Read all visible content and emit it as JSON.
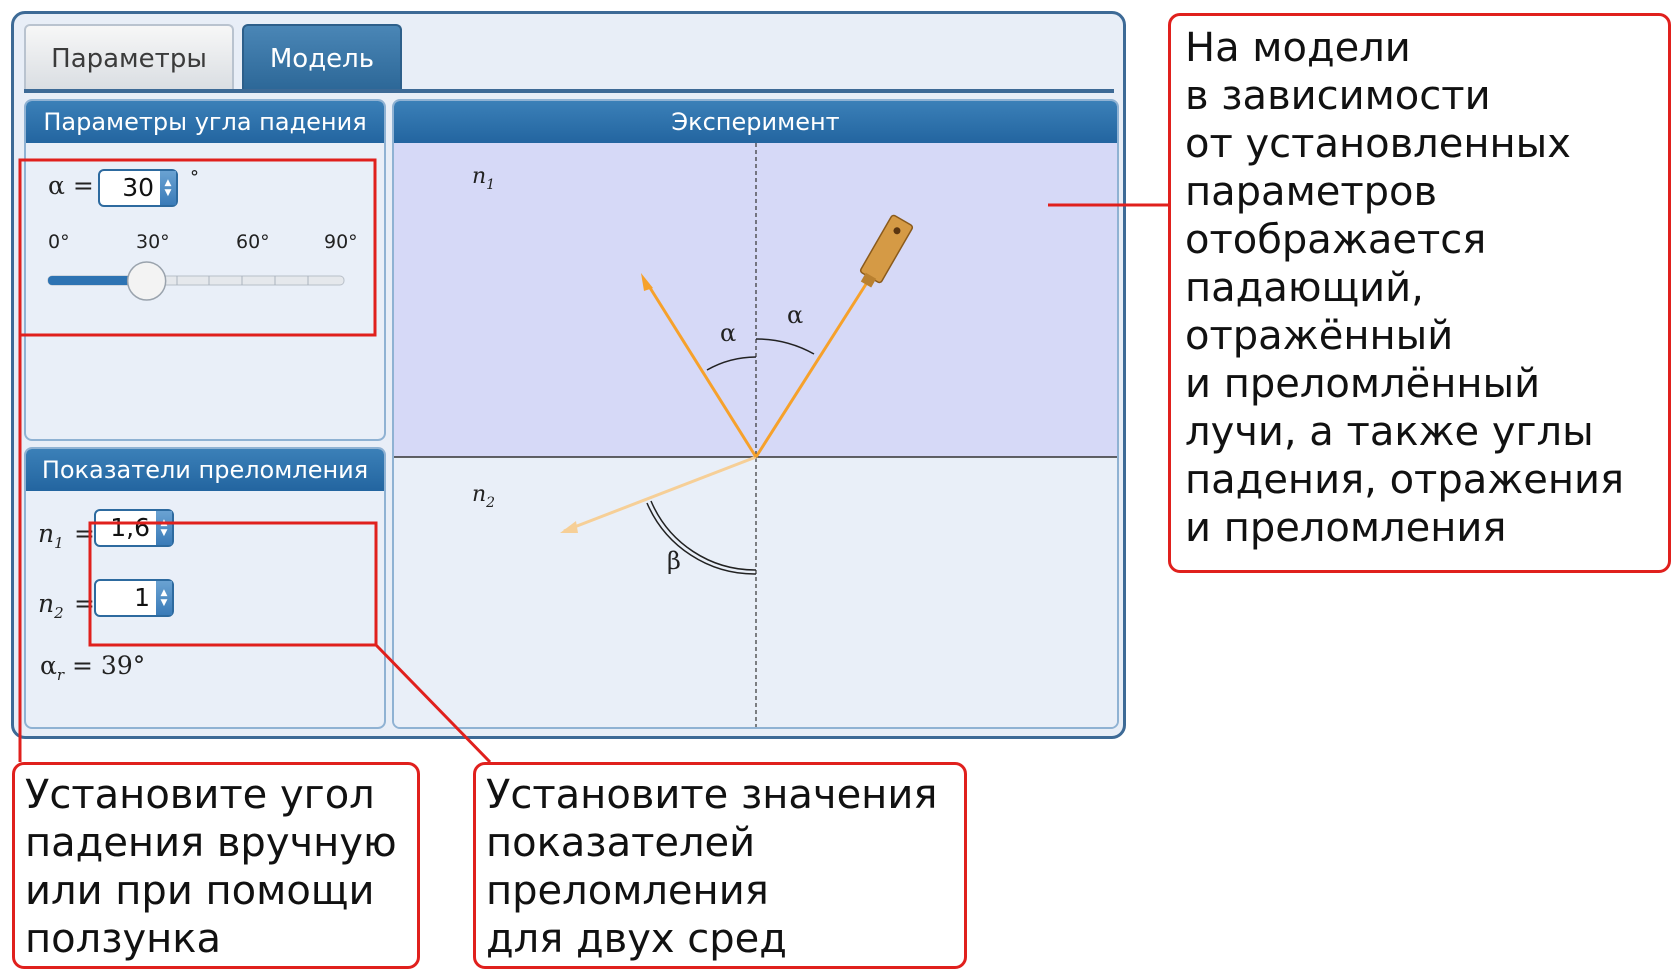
{
  "tabs": [
    {
      "label": "Параметры",
      "active": false
    },
    {
      "label": "Модель",
      "active": true
    }
  ],
  "angle_panel": {
    "title": "Параметры угла падения",
    "alpha_label": "α =",
    "alpha_value": "30",
    "degree": "°",
    "slider_ticks": [
      "0°",
      "30°",
      "60°",
      "90°"
    ],
    "slider_value_deg": 30,
    "slider_max_deg": 90
  },
  "index_panel": {
    "title": "Показатели преломления",
    "n1_label": "n",
    "n1_sub": "1",
    "n1_value": "1,6",
    "n2_label": "n",
    "n2_sub": "2",
    "n2_value": "1",
    "eq": "=",
    "critical_label": "α",
    "critical_sub": "r",
    "critical_value": "= 39°"
  },
  "experiment": {
    "title": "Эксперимент",
    "medium1": "n",
    "medium1_sub": "1",
    "medium2": "n",
    "medium2_sub": "2",
    "angle_incidence": "α",
    "angle_reflection": "α",
    "angle_refraction": "β",
    "colors": {
      "medium1": "#d6d9f7",
      "medium2": "#e9eff8",
      "ray": "#f6a12b",
      "accent": "#2c6797"
    }
  },
  "annotations": {
    "right": "На модели\nв зависимости\nот установленных\nпараметров\nотображается\nпадающий,\nотражённый\nи преломлённый\nлучи, а также углы\nпадения, отражения\nи преломления",
    "left": "Установите угол\nпадения вручную\nили при помощи\nползунка",
    "middle": "Установите значения\nпоказателей\nпреломления\nдля двух сред"
  }
}
